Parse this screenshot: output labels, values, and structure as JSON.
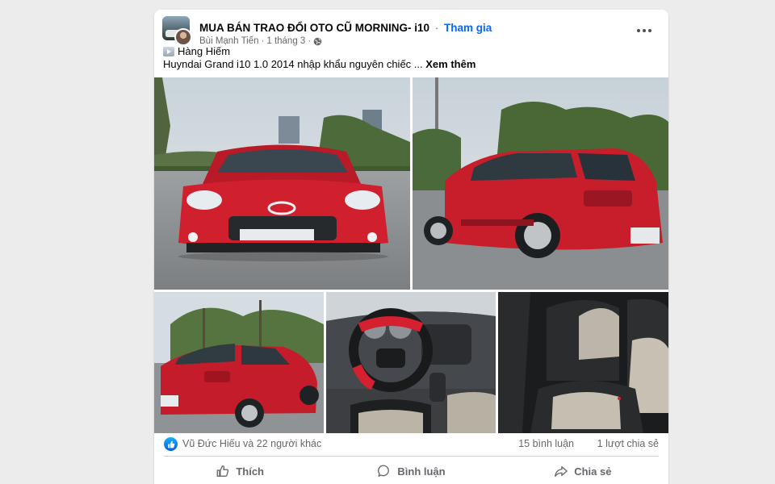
{
  "post": {
    "group_name": "MUA BÁN TRAO ĐỔI OTO CŨ MORNING- i10",
    "separator": "·",
    "join_label": "Tham gia",
    "author": "Bùi Mạnh Tiến",
    "date": "1 tháng 3",
    "audience_icon": "globe-icon",
    "tag": "Hàng Hiếm",
    "text": "Huyndai Grand i10 1.0 2014 nhập khẩu nguyên chiếc ...",
    "see_more": "Xem thêm"
  },
  "photos": [
    {
      "subject": "front view of red hatchback",
      "accent": "#cc1f2d"
    },
    {
      "subject": "rear three-quarter view of red hatchback",
      "accent": "#b81624"
    },
    {
      "subject": "rear view of red hatchback parked by trees",
      "accent": "#c41c2a"
    },
    {
      "subject": "dashboard and steering wheel interior",
      "accent": "#d3202f"
    },
    {
      "subject": "rear seats interior",
      "accent": "#bdb7ab"
    }
  ],
  "stats": {
    "reactions": "Vũ Đức Hiếu và 22 người khác",
    "comments": "15 bình luận",
    "shares": "1 lượt chia sẻ"
  },
  "actions": {
    "like": "Thích",
    "comment": "Bình luận",
    "share": "Chia sẻ"
  },
  "colors": {
    "link": "#0866ff",
    "secondary_text": "#65676b",
    "reaction_blue": "#0866ff"
  }
}
